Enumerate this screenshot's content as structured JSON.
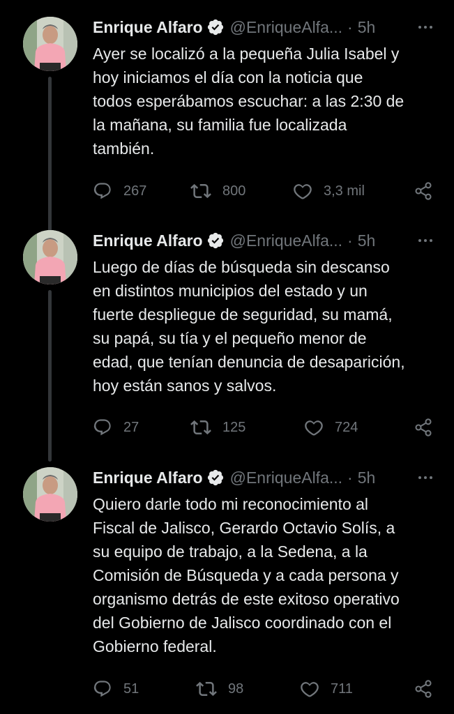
{
  "tweets": [
    {
      "author": {
        "name": "Enrique Alfaro",
        "handle": "@EnriqueAlfa...",
        "verified": true
      },
      "separator": "·",
      "time": "5h",
      "text": "Ayer se localizó a la pequeña Julia Isabel y\nhoy iniciamos el día con la noticia que\ntodos esperábamos escuchar: a las 2:30 de\nla mañana, su familia fue localizada\ntambién.",
      "stats": {
        "replies": "267",
        "retweets": "800",
        "likes": "3,3 mil"
      }
    },
    {
      "author": {
        "name": "Enrique Alfaro",
        "handle": "@EnriqueAlfa...",
        "verified": true
      },
      "separator": "·",
      "time": "5h",
      "text": "Luego de días de búsqueda sin descanso\nen distintos municipios del estado y un\nfuerte despliegue de seguridad, su mamá,\nsu papá, su tía y el pequeño menor de\nedad, que tenían denuncia de desaparición,\nhoy están sanos y salvos.",
      "stats": {
        "replies": "27",
        "retweets": "125",
        "likes": "724"
      }
    },
    {
      "author": {
        "name": "Enrique Alfaro",
        "handle": "@EnriqueAlfa...",
        "verified": true
      },
      "separator": "·",
      "time": "5h",
      "text": "Quiero darle todo mi reconocimiento al\nFiscal de Jalisco, Gerardo Octavio Solís, a\nsu equipo de trabajo, a la Sedena, a la\nComisión de Búsqueda y a cada persona y\norganismo detrás de este exitoso operativo\ndel Gobierno de Jalisco coordinado con el\nGobierno federal.",
      "stats": {
        "replies": "51",
        "retweets": "98",
        "likes": "711"
      }
    }
  ],
  "icons": {
    "reply": "reply-icon",
    "retweet": "retweet-icon",
    "like": "heart-icon",
    "share": "share-icon",
    "more": "more-icon",
    "verified": "verified-badge-icon"
  },
  "colors": {
    "background": "#000000",
    "text_primary": "#e7e9ea",
    "text_secondary": "#71767b",
    "thread_line": "#333639"
  }
}
